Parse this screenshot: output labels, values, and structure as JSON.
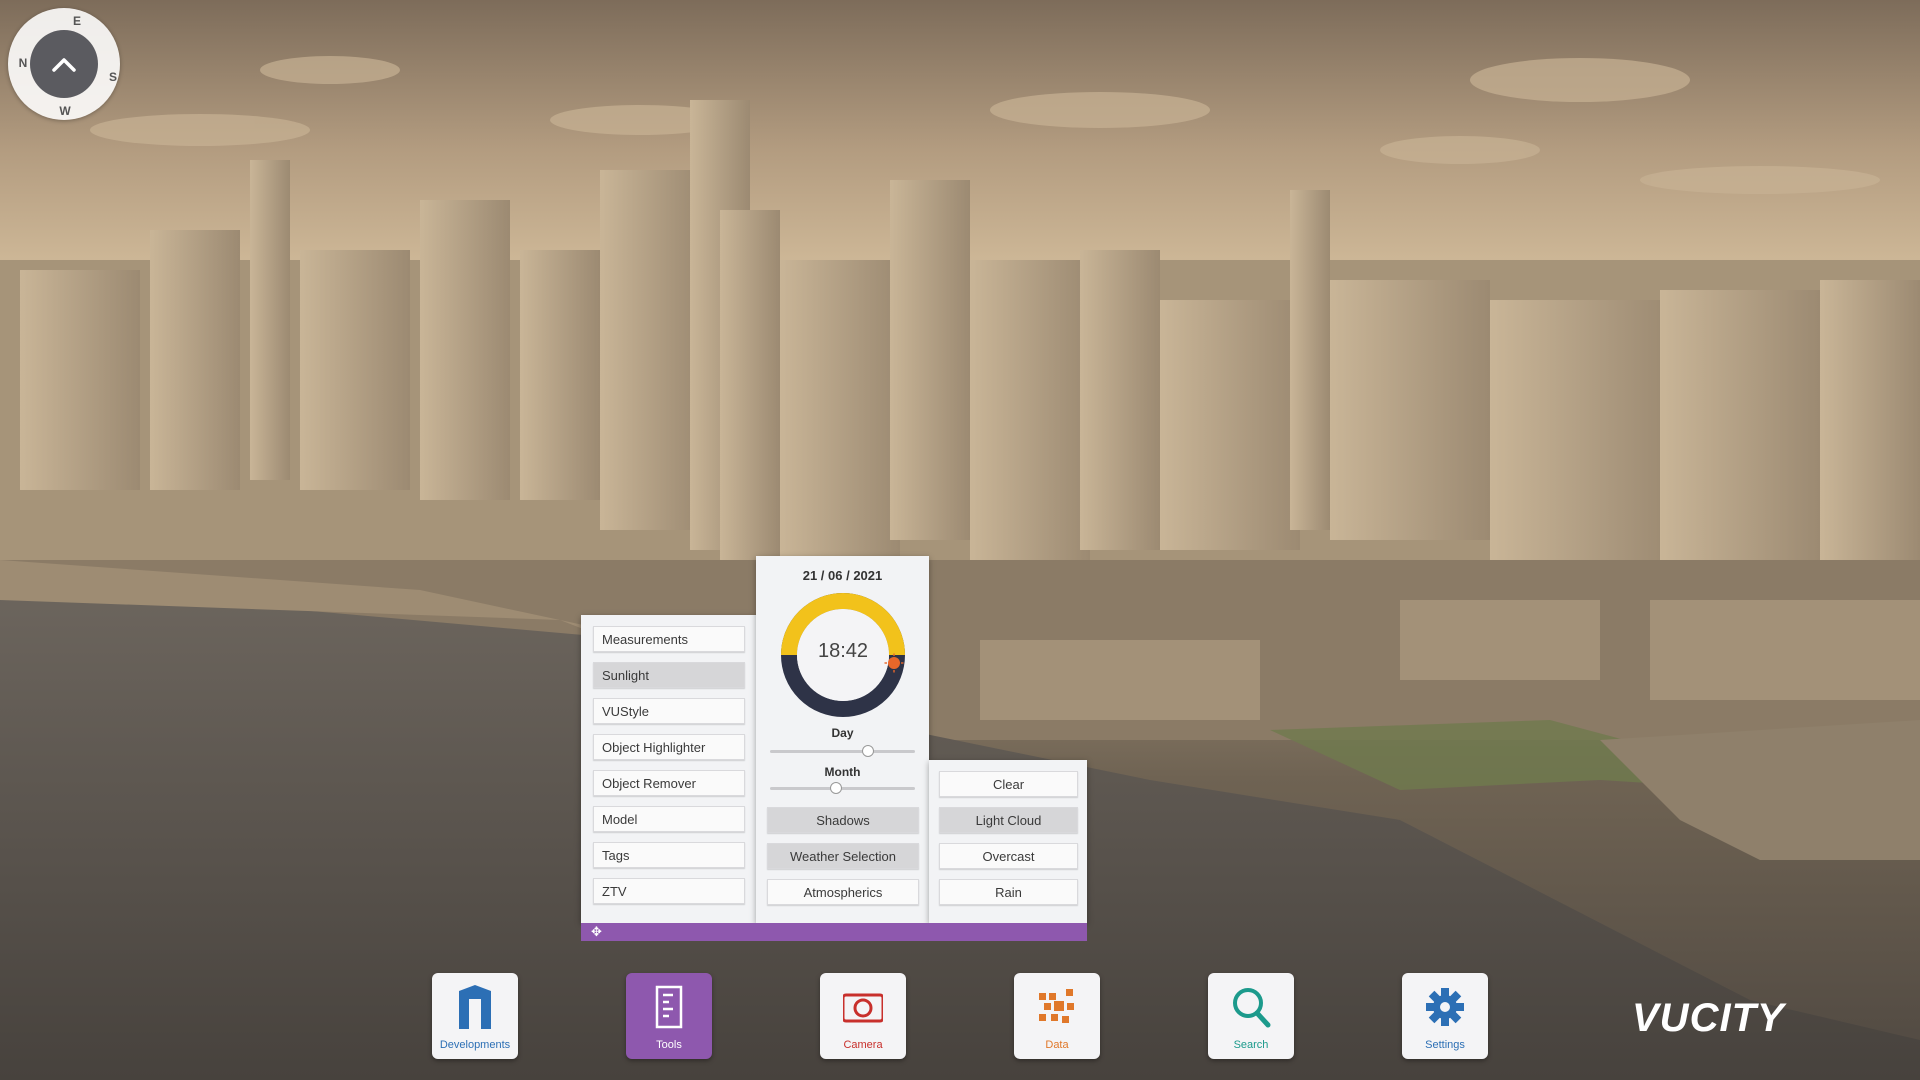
{
  "compass": {
    "n": "N",
    "e": "E",
    "s": "S",
    "w": "W"
  },
  "tools_menu": {
    "items": [
      {
        "label": "Measurements",
        "active": false
      },
      {
        "label": "Sunlight",
        "active": true
      },
      {
        "label": "VUStyle",
        "active": false
      },
      {
        "label": "Object Highlighter",
        "active": false
      },
      {
        "label": "Object Remover",
        "active": false
      },
      {
        "label": "Model",
        "active": false
      },
      {
        "label": "Tags",
        "active": false
      },
      {
        "label": "ZTV",
        "active": false
      }
    ]
  },
  "sunlight": {
    "date": "21 / 06 / 2021",
    "time": "18:42",
    "day_label": "Day",
    "day_value_fraction": 0.69,
    "month_label": "Month",
    "month_value_fraction": 0.45,
    "buttons": {
      "shadows": "Shadows",
      "weather_selection": "Weather Selection",
      "atmospherics": "Atmospherics"
    }
  },
  "weather": {
    "options": [
      {
        "label": "Clear",
        "active": false
      },
      {
        "label": "Light Cloud",
        "active": true
      },
      {
        "label": "Overcast",
        "active": false
      },
      {
        "label": "Rain",
        "active": false
      }
    ]
  },
  "dock": {
    "items": [
      {
        "label": "Developments",
        "icon": "developments-icon",
        "active": false,
        "color": "#2c6fb5"
      },
      {
        "label": "Tools",
        "icon": "tools-icon",
        "active": true,
        "color": "#ffffff"
      },
      {
        "label": "Camera",
        "icon": "camera-icon",
        "active": false,
        "color": "#c8302c"
      },
      {
        "label": "Data",
        "icon": "data-icon",
        "active": false,
        "color": "#e0782a"
      },
      {
        "label": "Search",
        "icon": "search-icon",
        "active": false,
        "color": "#1c9a8c"
      },
      {
        "label": "Settings",
        "icon": "settings-icon",
        "active": false,
        "color": "#2c6fb5"
      }
    ]
  },
  "brand": {
    "logo": "VUCITY",
    "accent": "#8e58ae"
  }
}
